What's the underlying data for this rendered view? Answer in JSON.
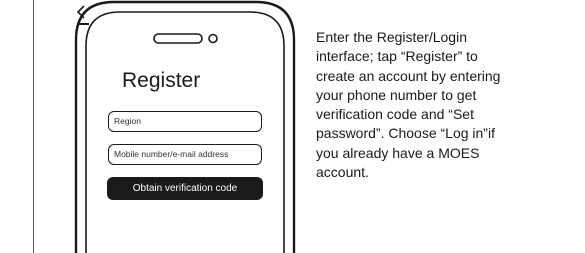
{
  "screen": {
    "title": "Register",
    "region_placeholder": "Region",
    "mobile_placeholder": "Mobile number/e-mail address",
    "obtain_button": "Obtain verification code"
  },
  "description": {
    "lines": [
      "Enter the Register/Login",
      "interface; tap “Register” to",
      "create an account by entering",
      "your phone number to get",
      "verification code and “Set",
      "password”. Choose “Log in”if",
      "you already have a MOES",
      "account."
    ]
  },
  "icons": [
    "back-chevron-icon",
    "speaker-slot-icon",
    "camera-dot-icon"
  ]
}
